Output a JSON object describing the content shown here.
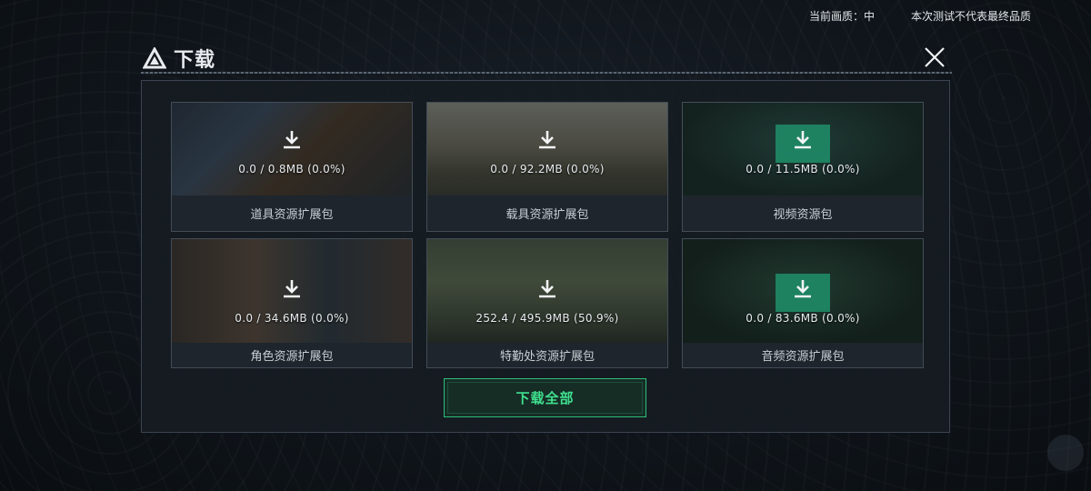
{
  "status": {
    "quality_label": "当前画质：中",
    "notice": "本次测试不代表最终品质"
  },
  "dialog": {
    "title": "下载",
    "close_icon": "close-icon",
    "download_all_label": "下载全部"
  },
  "packages": [
    {
      "name": "道具资源扩展包",
      "progress": "0.0 / 0.8MB (0.0%)"
    },
    {
      "name": "载具资源扩展包",
      "progress": "0.0 / 92.2MB (0.0%)"
    },
    {
      "name": "视频资源包",
      "progress": "0.0 / 11.5MB (0.0%)"
    },
    {
      "name": "角色资源扩展包",
      "progress": "0.0 / 34.6MB (0.0%)"
    },
    {
      "name": "特勤处资源扩展包",
      "progress": "252.4 / 495.9MB (50.9%)"
    },
    {
      "name": "音频资源扩展包",
      "progress": "0.0 / 83.6MB (0.0%)"
    }
  ],
  "colors": {
    "accent": "#3fe08e",
    "accent_box": "#1f8f6a"
  }
}
